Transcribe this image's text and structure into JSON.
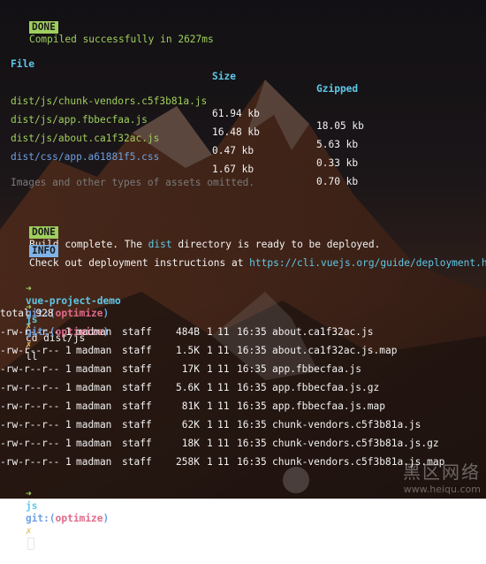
{
  "build": {
    "done_badge": "DONE",
    "compiled_text": "Compiled successfully in 2627ms",
    "headers": {
      "file": "File",
      "size": "Size",
      "gzipped": "Gzipped"
    },
    "files": [
      {
        "file": "dist/js/chunk-vendors.c5f3b81a.js",
        "size": "61.94 kb",
        "gzipped": "18.05 kb"
      },
      {
        "file": "dist/js/app.fbbecfaa.js",
        "size": "16.48 kb",
        "gzipped": "5.63 kb"
      },
      {
        "file": "dist/js/about.ca1f32ac.js",
        "size": "0.47 kb",
        "gzipped": "0.33 kb"
      },
      {
        "file": "dist/css/app.a61881f5.css",
        "size": "1.67 kb",
        "gzipped": "0.70 kb"
      }
    ],
    "omitted_note": "Images and other types of assets omitted.",
    "complete_badge": "DONE",
    "complete_pre": "Build complete. The ",
    "complete_dir": "dist",
    "complete_post": " directory is ready to be deployed.",
    "info_badge": "INFO",
    "info_text": "Check out deployment instructions at ",
    "info_link": "https://cli.vuejs.org/guide/deployment.html"
  },
  "shell": {
    "prompt1": {
      "arrow": "➜",
      "dir": "vue-project-demo",
      "git": "git:(",
      "branch": "optimize",
      "git_close": ")",
      "mark": "✗",
      "cmd": "cd dist/js"
    },
    "prompt2": {
      "arrow": "➜",
      "dir": "js",
      "git": "git:(",
      "branch": "optimize",
      "git_close": ")",
      "mark": "✗",
      "cmd": "ll"
    },
    "total": "total 928",
    "listing": [
      {
        "perm": "-rw-r--r--",
        "links": "1",
        "user": "madman",
        "group": "staff",
        "size": "484B",
        "month": "1",
        "day": "11",
        "time": "16:35",
        "name": "about.ca1f32ac.js"
      },
      {
        "perm": "-rw-r--r--",
        "links": "1",
        "user": "madman",
        "group": "staff",
        "size": "1.5K",
        "month": "1",
        "day": "11",
        "time": "16:35",
        "name": "about.ca1f32ac.js.map"
      },
      {
        "perm": "-rw-r--r--",
        "links": "1",
        "user": "madman",
        "group": "staff",
        "size": "17K",
        "month": "1",
        "day": "11",
        "time": "16:35",
        "name": "app.fbbecfaa.js"
      },
      {
        "perm": "-rw-r--r--",
        "links": "1",
        "user": "madman",
        "group": "staff",
        "size": "5.6K",
        "month": "1",
        "day": "11",
        "time": "16:35",
        "name": "app.fbbecfaa.js.gz"
      },
      {
        "perm": "-rw-r--r--",
        "links": "1",
        "user": "madman",
        "group": "staff",
        "size": "81K",
        "month": "1",
        "day": "11",
        "time": "16:35",
        "name": "app.fbbecfaa.js.map"
      },
      {
        "perm": "-rw-r--r--",
        "links": "1",
        "user": "madman",
        "group": "staff",
        "size": "62K",
        "month": "1",
        "day": "11",
        "time": "16:35",
        "name": "chunk-vendors.c5f3b81a.js"
      },
      {
        "perm": "-rw-r--r--",
        "links": "1",
        "user": "madman",
        "group": "staff",
        "size": "18K",
        "month": "1",
        "day": "11",
        "time": "16:35",
        "name": "chunk-vendors.c5f3b81a.js.gz"
      },
      {
        "perm": "-rw-r--r--",
        "links": "1",
        "user": "madman",
        "group": "staff",
        "size": "258K",
        "month": "1",
        "day": "11",
        "time": "16:35",
        "name": "chunk-vendors.c5f3b81a.js.map"
      }
    ],
    "prompt3": {
      "arrow": "➜",
      "dir": "js",
      "git": "git:(",
      "branch": "optimize",
      "git_close": ")",
      "mark": "✗"
    }
  },
  "watermark": {
    "text": "黑区网络",
    "url": "www.heiqu.com"
  },
  "colors": {
    "done": "#9fcf5d",
    "info": "#7fb3e8",
    "branch": "#e06a8a",
    "file": "#9fcf5d",
    "css": "#6ea0e0"
  }
}
